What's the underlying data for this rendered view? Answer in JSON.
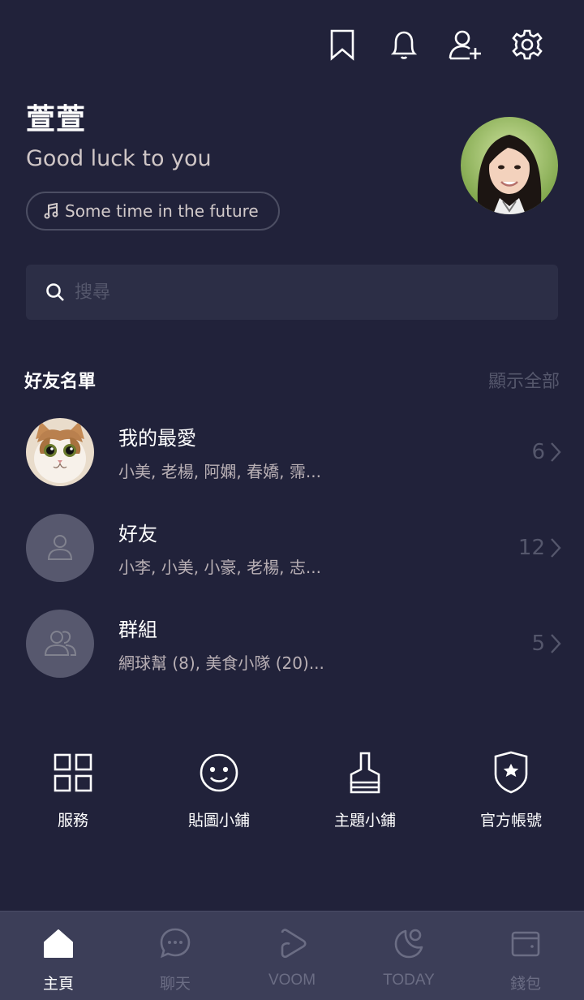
{
  "profile": {
    "name": "萱萱",
    "status_message": "Good luck to you",
    "music": "Some time in the future"
  },
  "search": {
    "placeholder": "搜尋"
  },
  "friends": {
    "title": "好友名單",
    "show_all": "顯示全部",
    "rows": [
      {
        "title": "我的最愛",
        "subtitle": "小美, 老楊, 阿嫻, 春嬌, 霈...",
        "count": "6"
      },
      {
        "title": "好友",
        "subtitle": "小李, 小美, 小豪, 老楊, 志...",
        "count": "12"
      },
      {
        "title": "群組",
        "subtitle": "網球幫 (8), 美食小隊 (20)...",
        "count": "5"
      }
    ]
  },
  "services": [
    {
      "label": "服務",
      "icon": "grid-icon"
    },
    {
      "label": "貼圖小鋪",
      "icon": "smiley-icon"
    },
    {
      "label": "主題小鋪",
      "icon": "brush-icon"
    },
    {
      "label": "官方帳號",
      "icon": "shield-star-icon"
    }
  ],
  "nav": [
    {
      "label": "主頁",
      "icon": "home-icon",
      "active": true
    },
    {
      "label": "聊天",
      "icon": "chat-icon",
      "active": false
    },
    {
      "label": "VOOM",
      "icon": "voom-play-icon",
      "active": false
    },
    {
      "label": "TODAY",
      "icon": "today-icon",
      "active": false
    },
    {
      "label": "錢包",
      "icon": "wallet-icon",
      "active": false
    }
  ],
  "top_icons": [
    "bookmark-icon",
    "bell-icon",
    "add-friend-icon",
    "settings-icon"
  ],
  "colors": {
    "background": "#21223a",
    "nav_background": "#3c3e58",
    "muted": "#55576c"
  }
}
